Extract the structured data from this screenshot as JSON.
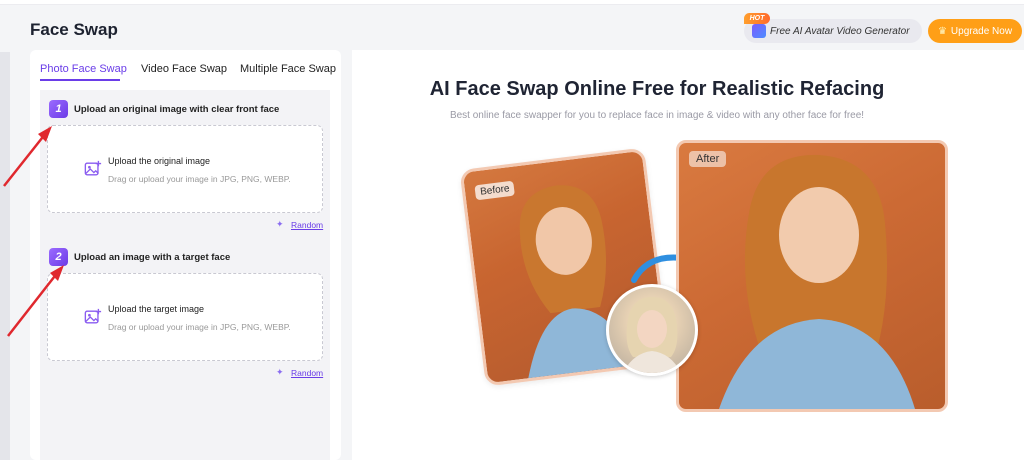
{
  "header": {
    "title": "Face Swap",
    "hot_badge": "HOT",
    "avatar_btn": "Free AI Avatar Video Generator",
    "upgrade_btn": "Upgrade Now"
  },
  "tabs": [
    "Photo Face Swap",
    "Video Face Swap",
    "Multiple Face Swap"
  ],
  "steps": [
    {
      "num": "1",
      "label": "Upload an original image with clear front face",
      "upload_title": "Upload the original image",
      "upload_sub": "Drag or upload your image in JPG, PNG, WEBP.",
      "random": "Random"
    },
    {
      "num": "2",
      "label": "Upload an image with a target face",
      "upload_title": "Upload the target image",
      "upload_sub": "Drag or upload your image in JPG, PNG, WEBP.",
      "random": "Random"
    }
  ],
  "hero": {
    "title": "AI Face Swap Online Free for Realistic Refacing",
    "subtitle": "Best online face swapper for you to replace face in image & video with any other face for free!",
    "before_label": "Before",
    "after_label": "After"
  },
  "colors": {
    "accent": "#6a3de8",
    "upgrade": "#ff9f17",
    "annotation_arrow": "#e0282e"
  },
  "icons": [
    "image-upload-icon",
    "wand-icon",
    "crown-icon",
    "swap-arrow-icon"
  ]
}
